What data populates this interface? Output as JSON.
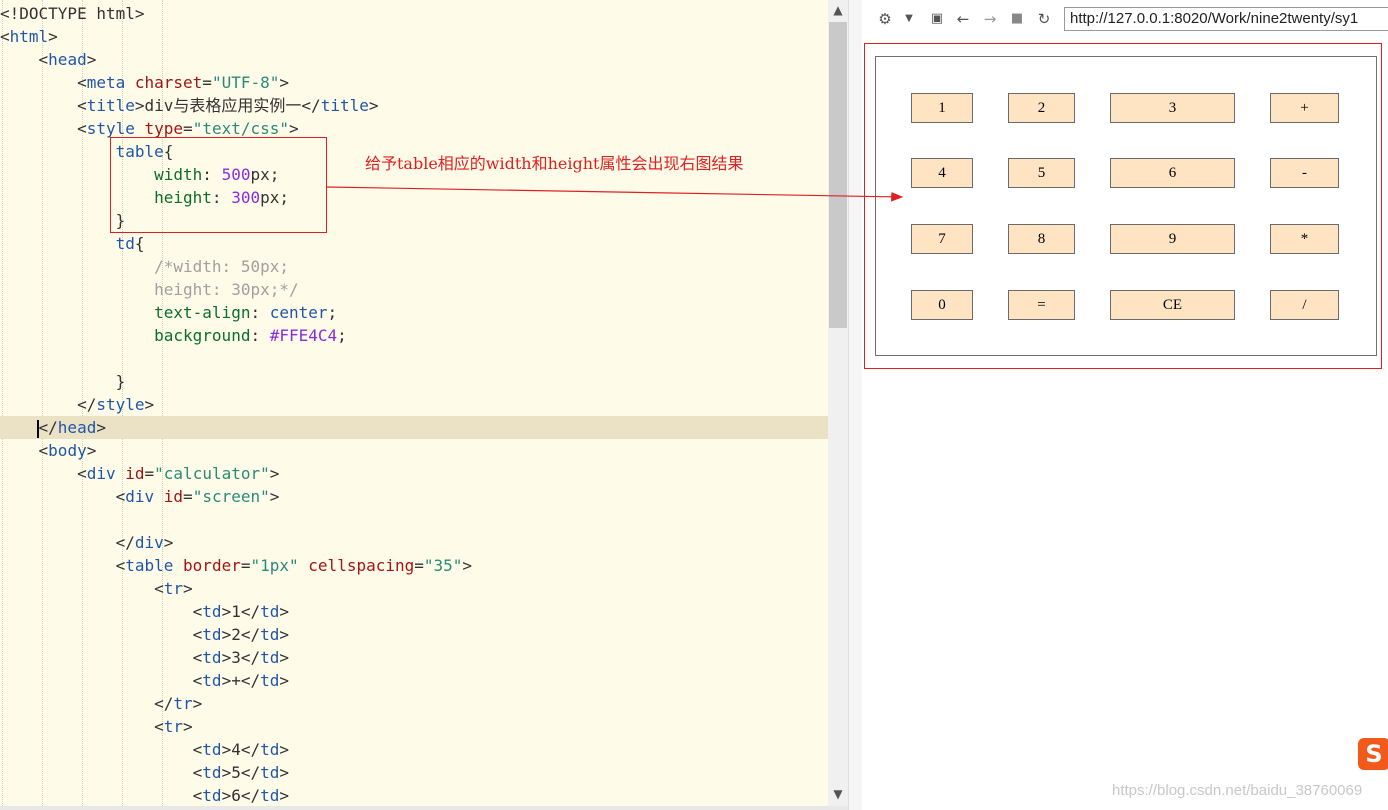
{
  "editor": {
    "lines": [
      [
        {
          "t": "<!DOCTYPE html>",
          "c": "plain"
        }
      ],
      [
        {
          "t": "<",
          "c": "punct"
        },
        {
          "t": "html",
          "c": "tag"
        },
        {
          "t": ">",
          "c": "punct"
        }
      ],
      [
        {
          "t": "    <",
          "c": "punct"
        },
        {
          "t": "head",
          "c": "tag"
        },
        {
          "t": ">",
          "c": "punct"
        }
      ],
      [
        {
          "t": "        <",
          "c": "punct"
        },
        {
          "t": "meta",
          "c": "tag"
        },
        {
          "t": " charset",
          "c": "attr"
        },
        {
          "t": "=",
          "c": "punct"
        },
        {
          "t": "\"UTF-8\"",
          "c": "str"
        },
        {
          "t": ">",
          "c": "punct"
        }
      ],
      [
        {
          "t": "        <",
          "c": "punct"
        },
        {
          "t": "title",
          "c": "tag"
        },
        {
          "t": ">div与表格应用实例一</",
          "c": "plain"
        },
        {
          "t": "title",
          "c": "tag"
        },
        {
          "t": ">",
          "c": "punct"
        }
      ],
      [
        {
          "t": "        <",
          "c": "punct"
        },
        {
          "t": "style",
          "c": "tag"
        },
        {
          "t": " type",
          "c": "attr"
        },
        {
          "t": "=",
          "c": "punct"
        },
        {
          "t": "\"text/css\"",
          "c": "str"
        },
        {
          "t": ">",
          "c": "punct"
        }
      ],
      [
        {
          "t": "            table",
          "c": "sel"
        },
        {
          "t": "{",
          "c": "punct"
        }
      ],
      [
        {
          "t": "                width",
          "c": "kw"
        },
        {
          "t": ": ",
          "c": "punct"
        },
        {
          "t": "500",
          "c": "num"
        },
        {
          "t": "px;",
          "c": "plain"
        }
      ],
      [
        {
          "t": "                height",
          "c": "kw"
        },
        {
          "t": ": ",
          "c": "punct"
        },
        {
          "t": "300",
          "c": "num"
        },
        {
          "t": "px;",
          "c": "plain"
        }
      ],
      [
        {
          "t": "            }",
          "c": "punct"
        }
      ],
      [
        {
          "t": "            td",
          "c": "sel"
        },
        {
          "t": "{",
          "c": "punct"
        }
      ],
      [
        {
          "t": "                /*width: 50px;",
          "c": "com"
        }
      ],
      [
        {
          "t": "                height: 30px;*/",
          "c": "com"
        }
      ],
      [
        {
          "t": "                text-align",
          "c": "kw"
        },
        {
          "t": ": ",
          "c": "punct"
        },
        {
          "t": "center",
          "c": "val"
        },
        {
          "t": ";",
          "c": "punct"
        }
      ],
      [
        {
          "t": "                background",
          "c": "kw"
        },
        {
          "t": ": ",
          "c": "punct"
        },
        {
          "t": "#FFE4C4",
          "c": "hex"
        },
        {
          "t": ";",
          "c": "punct"
        }
      ],
      [],
      [
        {
          "t": "            }",
          "c": "punct"
        }
      ],
      [
        {
          "t": "        </",
          "c": "punct"
        },
        {
          "t": "style",
          "c": "tag"
        },
        {
          "t": ">",
          "c": "punct"
        }
      ],
      [
        {
          "t": "    ",
          "c": "punct"
        },
        {
          "t": "caret",
          "c": "caret"
        },
        {
          "t": "</",
          "c": "punct"
        },
        {
          "t": "head",
          "c": "tag"
        },
        {
          "t": ">",
          "c": "punct"
        }
      ],
      [
        {
          "t": "    <",
          "c": "punct"
        },
        {
          "t": "body",
          "c": "tag"
        },
        {
          "t": ">",
          "c": "punct"
        }
      ],
      [
        {
          "t": "        <",
          "c": "punct"
        },
        {
          "t": "div",
          "c": "tag"
        },
        {
          "t": " id",
          "c": "attr"
        },
        {
          "t": "=",
          "c": "punct"
        },
        {
          "t": "\"calculator\"",
          "c": "str"
        },
        {
          "t": ">",
          "c": "punct"
        }
      ],
      [
        {
          "t": "            <",
          "c": "punct"
        },
        {
          "t": "div",
          "c": "tag"
        },
        {
          "t": " id",
          "c": "attr"
        },
        {
          "t": "=",
          "c": "punct"
        },
        {
          "t": "\"screen\"",
          "c": "str"
        },
        {
          "t": ">",
          "c": "punct"
        }
      ],
      [],
      [
        {
          "t": "            </",
          "c": "punct"
        },
        {
          "t": "div",
          "c": "tag"
        },
        {
          "t": ">",
          "c": "punct"
        }
      ],
      [
        {
          "t": "            <",
          "c": "punct"
        },
        {
          "t": "table",
          "c": "tag"
        },
        {
          "t": " border",
          "c": "attr"
        },
        {
          "t": "=",
          "c": "punct"
        },
        {
          "t": "\"1px\"",
          "c": "str"
        },
        {
          "t": " cellspacing",
          "c": "attr"
        },
        {
          "t": "=",
          "c": "punct"
        },
        {
          "t": "\"35\"",
          "c": "str"
        },
        {
          "t": ">",
          "c": "punct"
        }
      ],
      [
        {
          "t": "                <",
          "c": "punct"
        },
        {
          "t": "tr",
          "c": "tag"
        },
        {
          "t": ">",
          "c": "punct"
        }
      ],
      [
        {
          "t": "                    <",
          "c": "punct"
        },
        {
          "t": "td",
          "c": "tag"
        },
        {
          "t": ">1</",
          "c": "plain"
        },
        {
          "t": "td",
          "c": "tag"
        },
        {
          "t": ">",
          "c": "punct"
        }
      ],
      [
        {
          "t": "                    <",
          "c": "punct"
        },
        {
          "t": "td",
          "c": "tag"
        },
        {
          "t": ">2</",
          "c": "plain"
        },
        {
          "t": "td",
          "c": "tag"
        },
        {
          "t": ">",
          "c": "punct"
        }
      ],
      [
        {
          "t": "                    <",
          "c": "punct"
        },
        {
          "t": "td",
          "c": "tag"
        },
        {
          "t": ">3</",
          "c": "plain"
        },
        {
          "t": "td",
          "c": "tag"
        },
        {
          "t": ">",
          "c": "punct"
        }
      ],
      [
        {
          "t": "                    <",
          "c": "punct"
        },
        {
          "t": "td",
          "c": "tag"
        },
        {
          "t": ">+</",
          "c": "plain"
        },
        {
          "t": "td",
          "c": "tag"
        },
        {
          "t": ">",
          "c": "punct"
        }
      ],
      [
        {
          "t": "                </",
          "c": "punct"
        },
        {
          "t": "tr",
          "c": "tag"
        },
        {
          "t": ">",
          "c": "punct"
        }
      ],
      [
        {
          "t": "                <",
          "c": "punct"
        },
        {
          "t": "tr",
          "c": "tag"
        },
        {
          "t": ">",
          "c": "punct"
        }
      ],
      [
        {
          "t": "                    <",
          "c": "punct"
        },
        {
          "t": "td",
          "c": "tag"
        },
        {
          "t": ">4</",
          "c": "plain"
        },
        {
          "t": "td",
          "c": "tag"
        },
        {
          "t": ">",
          "c": "punct"
        }
      ],
      [
        {
          "t": "                    <",
          "c": "punct"
        },
        {
          "t": "td",
          "c": "tag"
        },
        {
          "t": ">5</",
          "c": "plain"
        },
        {
          "t": "td",
          "c": "tag"
        },
        {
          "t": ">",
          "c": "punct"
        }
      ],
      [
        {
          "t": "                    <",
          "c": "punct"
        },
        {
          "t": "td",
          "c": "tag"
        },
        {
          "t": ">6</",
          "c": "plain"
        },
        {
          "t": "td",
          "c": "tag"
        },
        {
          "t": ">",
          "c": "punct"
        }
      ]
    ],
    "active_line": 18
  },
  "browser": {
    "url": "http://127.0.0.1:8020/Work/nine2twenty/sy1",
    "toolbar_icons": [
      "gear-icon",
      "dropdown-icon",
      "console-icon",
      "back-icon",
      "forward-icon",
      "stop-icon",
      "reload-icon"
    ],
    "calc_rows": [
      [
        "1",
        "2",
        "3",
        "+"
      ],
      [
        "4",
        "5",
        "6",
        "-"
      ],
      [
        "7",
        "8",
        "9",
        "*"
      ],
      [
        "0",
        "=",
        "CE",
        "/"
      ]
    ]
  },
  "annotation": {
    "text": "给予table相应的width和height属性会出现右图结果",
    "color": "#e02020"
  },
  "watermark": "https://blog.csdn.net/baidu_38760069",
  "colors": {
    "cell_background": "#FFE4C4",
    "annotation_red": "#e02020",
    "editor_background": "#fefbe9"
  }
}
